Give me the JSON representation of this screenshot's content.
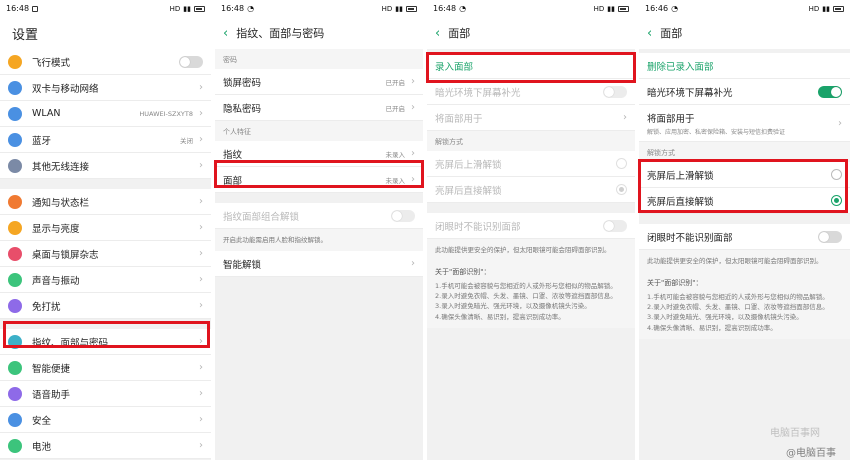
{
  "status": {
    "p1_time": "16:48",
    "p2_time": "16:48",
    "p3_time": "16:48",
    "p4_time": "16:46",
    "right_text": "HD"
  },
  "panel1": {
    "title": "设置",
    "group1": [
      {
        "label": "飞行模式",
        "icon": "plane-icon",
        "color": "#f5a623"
      },
      {
        "label": "双卡与移动网络",
        "icon": "sim-icon",
        "color": "#4a90e2"
      },
      {
        "label": "WLAN",
        "value": "HUAWEI-SZXYT8",
        "icon": "wifi-icon",
        "color": "#4a90e2"
      },
      {
        "label": "蓝牙",
        "value": "关闭",
        "icon": "bluetooth-icon",
        "color": "#4a90e2"
      },
      {
        "label": "其他无线连接",
        "icon": "more-icon",
        "color": "#7b8aa6"
      }
    ],
    "group2": [
      {
        "label": "通知与状态栏",
        "icon": "notification-icon",
        "color": "#f07a32"
      },
      {
        "label": "显示与亮度",
        "icon": "display-icon",
        "color": "#f5a623"
      },
      {
        "label": "桌面与锁屏杂志",
        "icon": "desktop-icon",
        "color": "#e84e6a"
      },
      {
        "label": "声音与振动",
        "icon": "sound-icon",
        "color": "#3cc47c"
      },
      {
        "label": "免打扰",
        "icon": "moon-icon",
        "color": "#8e6ae8"
      }
    ],
    "group3": [
      {
        "label": "指纹、面部与密码",
        "icon": "fingerprint-icon",
        "color": "#3cb0c8"
      },
      {
        "label": "智能便捷",
        "icon": "smart-icon",
        "color": "#3cc47c"
      },
      {
        "label": "语音助手",
        "icon": "mic-icon",
        "color": "#8e6ae8"
      },
      {
        "label": "安全",
        "icon": "shield-icon",
        "color": "#4a90e2"
      },
      {
        "label": "电池",
        "icon": "battery-icon",
        "color": "#3cc47c"
      }
    ]
  },
  "panel2": {
    "title": "指纹、面部与密码",
    "section_password": "密码",
    "lock_password": "锁屏密码",
    "lock_value": "已开启",
    "privacy_password": "隐私密码",
    "privacy_value": "已开启",
    "section_personal": "个人特征",
    "fingerprint": "指纹",
    "fingerprint_value": "未录入",
    "face": "面部",
    "face_value": "未录入",
    "combo_unlock": "指纹面部组合解锁",
    "note": "开启此功能需启用人脸和指纹解锁。",
    "smart_unlock": "智能解锁"
  },
  "panel3": {
    "title": "面部",
    "enroll": "录入面部",
    "dim_light": "暗光环境下屏幕补光",
    "use_for": "将面部用于",
    "section_unlock": "解锁方式",
    "swipe_unlock": "亮屏后上滑解锁",
    "direct_unlock": "亮屏后直接解锁",
    "closed_eyes": "闭眼时不能识别面部",
    "closed_note": "此功能提供更安全的保护，但太阳眼镜可能会阻碍面部识别。",
    "about_title": "关于\"面部识别\"：",
    "about_lines": [
      "1.手机可能会被容貌与您相近的人或外形与您相似的物品解锁。",
      "2.录入时避免衣帽、头发、墨镜、口罩、浓妆等遮挡面部信息。",
      "3.录入时避免暗光、强光环境，以及摄像机镜头污染。",
      "4.确保头像清晰、易识别，提高识别成功率。"
    ]
  },
  "panel4": {
    "title": "面部",
    "delete": "删除已录入面部",
    "dim_light": "暗光环境下屏幕补光",
    "use_for": "将面部用于",
    "use_for_sub": "解锁、应用加密、私密保险箱、安装与短信扣费验证",
    "section_unlock": "解锁方式",
    "swipe_unlock": "亮屏后上滑解锁",
    "direct_unlock": "亮屏后直接解锁",
    "closed_eyes": "闭眼时不能识别面部",
    "closed_note": "此功能提供更安全的保护，但太阳眼镜可能会阻碍面部识别。",
    "about_title": "关于\"面部识别\"：",
    "about_lines": [
      "1.手机可能会被容貌与您相近的人或外形与您相似的物品解锁。",
      "2.录入时避免衣帽、头发、墨镜、口罩、浓妆等遮挡面部信息。",
      "3.录入时避免暗光、强光环境，以及摄像机镜头污染。",
      "4.确保头像清晰、易识别，提高识别成功率。"
    ]
  },
  "watermark": {
    "line1": "电脑百事网",
    "line2": "@电脑百事"
  },
  "colors": {
    "accent": "#1aa36a",
    "highlight": "#e0141e"
  }
}
